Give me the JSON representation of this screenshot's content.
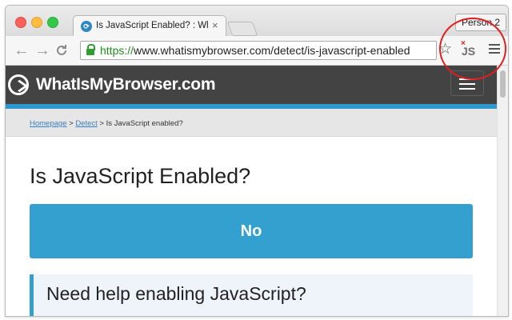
{
  "browser": {
    "tab_title": "Is JavaScript Enabled? : Wh",
    "tab_favicon": "whatismybrowser-favicon",
    "close_glyph": "×",
    "profile_button": "Person 2",
    "nav": {
      "back": "←",
      "forward": "→",
      "reload": "C"
    },
    "url_scheme": "https://",
    "url_rest": "www.whatismybrowser.com/detect/is-javascript-enabled",
    "star_glyph": "☆",
    "extension_label": "JS",
    "extension_badge": "×"
  },
  "site": {
    "logo_text": "WhatIsMyBrowser.com",
    "breadcrumb": {
      "home": "Homepage",
      "sep1": " > ",
      "detect": "Detect",
      "sep2": " > ",
      "current": "Is JavaScript enabled?"
    },
    "heading": "Is JavaScript Enabled?",
    "result": "No",
    "help_heading": "Need help enabling JavaScript?"
  },
  "colors": {
    "header_bg": "#434343",
    "accent": "#34a0d0",
    "annotation": "#e01e1e"
  }
}
